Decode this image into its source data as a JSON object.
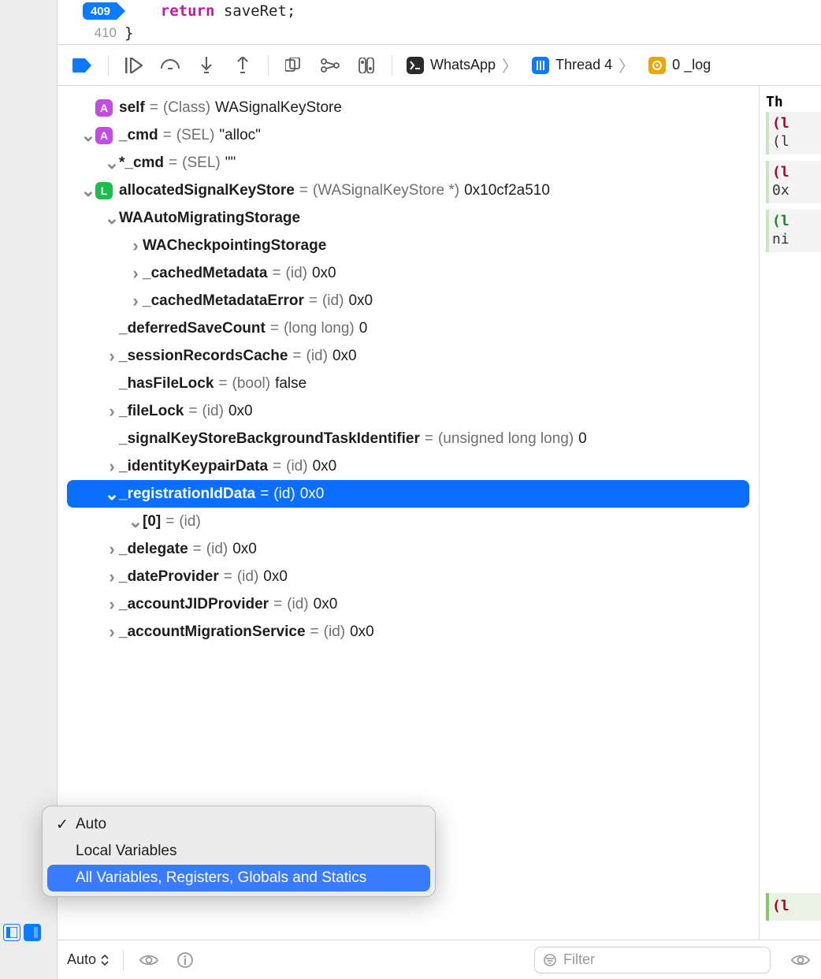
{
  "code": {
    "line409_num": "409",
    "line409_kw": "return",
    "line409_rest": " saveRet;",
    "line410_num": "410",
    "line410_text": "}"
  },
  "toolbar": {
    "process": "WhatsApp",
    "thread": "Thread 4",
    "frame": "0 _log"
  },
  "vars": [
    {
      "depth": 0,
      "disc": "",
      "badge": "A",
      "name": "self",
      "type": "(Class)",
      "val": "WASignalKeyStore"
    },
    {
      "depth": 0,
      "disc": "v",
      "badge": "A",
      "name": "_cmd",
      "type": "(SEL)",
      "val": "\"alloc\""
    },
    {
      "depth": 1,
      "disc": "v",
      "badge": "",
      "name": "*_cmd",
      "type": "(SEL)",
      "val": "\"\""
    },
    {
      "depth": 0,
      "disc": "v",
      "badge": "L",
      "name": "allocatedSignalKeyStore",
      "type": "(WASignalKeyStore *)",
      "val": "0x10cf2a510"
    },
    {
      "depth": 1,
      "disc": "v",
      "badge": "",
      "name": "WAAutoMigratingStorage",
      "type": "",
      "val": ""
    },
    {
      "depth": 2,
      "disc": ">",
      "badge": "",
      "name": "WACheckpointingStorage",
      "type": "",
      "val": ""
    },
    {
      "depth": 2,
      "disc": ">",
      "badge": "",
      "name": "_cachedMetadata",
      "type": "(id)",
      "val": "0x0"
    },
    {
      "depth": 2,
      "disc": ">",
      "badge": "",
      "name": "_cachedMetadataError",
      "type": "(id)",
      "val": "0x0"
    },
    {
      "depth": 1,
      "disc": "",
      "badge": "",
      "name": "_deferredSaveCount",
      "type": "(long long)",
      "val": "0"
    },
    {
      "depth": 1,
      "disc": ">",
      "badge": "",
      "name": "_sessionRecordsCache",
      "type": "(id)",
      "val": "0x0"
    },
    {
      "depth": 1,
      "disc": "",
      "badge": "",
      "name": "_hasFileLock",
      "type": "(bool)",
      "val": "false"
    },
    {
      "depth": 1,
      "disc": ">",
      "badge": "",
      "name": "_fileLock",
      "type": "(id)",
      "val": "0x0"
    },
    {
      "depth": 1,
      "disc": "",
      "badge": "",
      "name": "_signalKeyStoreBackgroundTaskIdentifier",
      "type": "(unsigned long long)",
      "val": "0"
    },
    {
      "depth": 1,
      "disc": ">",
      "badge": "",
      "name": "_identityKeypairData",
      "type": "(id)",
      "val": "0x0"
    },
    {
      "depth": 1,
      "disc": "v",
      "badge": "",
      "name": "_registrationIdData",
      "type": "(id)",
      "val": "0x0",
      "selected": true
    },
    {
      "depth": 2,
      "disc": "v",
      "badge": "",
      "name": "[0]",
      "type": "(id)",
      "val": ""
    },
    {
      "depth": 1,
      "disc": ">",
      "badge": "",
      "name": "_delegate",
      "type": "(id)",
      "val": "0x0"
    },
    {
      "depth": 1,
      "disc": ">",
      "badge": "",
      "name": "_dateProvider",
      "type": "(id)",
      "val": "0x0"
    },
    {
      "depth": 1,
      "disc": ">",
      "badge": "",
      "name": "_accountJIDProvider",
      "type": "(id)",
      "val": "0x0"
    },
    {
      "depth": 1,
      "disc": ">",
      "badge": "",
      "name": "_accountMigrationService",
      "type": "(id)",
      "val": "0x0"
    }
  ],
  "console": {
    "header": "Th",
    "g1a": "(l",
    "g1b": "(l",
    "g2a": "(l",
    "g2b": "0x",
    "g3a": "(l",
    "g3b": "ni",
    "g4a": "(l"
  },
  "popup": {
    "items": [
      {
        "label": "Auto",
        "checked": true,
        "hl": false
      },
      {
        "label": "Local Variables",
        "checked": false,
        "hl": false
      },
      {
        "label": "All Variables, Registers, Globals and Statics",
        "checked": false,
        "hl": true
      }
    ]
  },
  "bottombar": {
    "auto_label": "Auto",
    "filter_placeholder": "Filter"
  }
}
